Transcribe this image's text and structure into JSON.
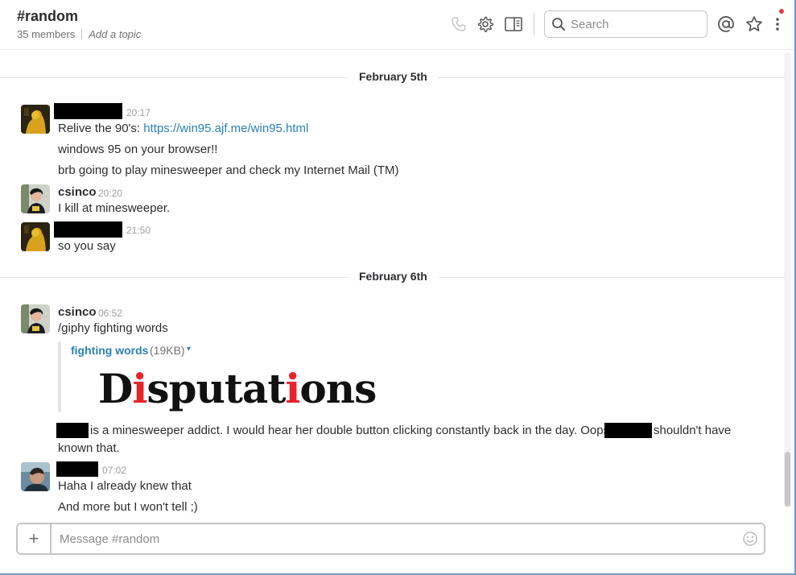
{
  "header": {
    "channel_name": "#random",
    "member_count": "35 members",
    "topic_placeholder": "Add a topic",
    "search_placeholder": "Search"
  },
  "days": [
    {
      "label": "February 5th"
    },
    {
      "label": "February 6th"
    }
  ],
  "messages": [
    {
      "author": "",
      "redacted_author": true,
      "time": "20:17",
      "lines": [
        "Relive the 90's: ",
        "windows 95 on your browser!!",
        "brb going to play minesweeper and check my Internet Mail (TM)"
      ],
      "link": "https://win95.ajf.me/win95.html"
    },
    {
      "author": "csinco",
      "time": "20:20",
      "lines": [
        "I kill at minesweeper."
      ]
    },
    {
      "author": "",
      "redacted_author": true,
      "time": "21:50",
      "lines": [
        "so you say"
      ]
    },
    {
      "author": "csinco",
      "time": "06:52",
      "lines": [
        "/giphy fighting words"
      ]
    },
    {
      "author": "",
      "redacted_author": true,
      "time": "07:02",
      "lines": [
        "Haha I already knew that",
        "And more but I won't tell ;)"
      ]
    }
  ],
  "giphy": {
    "title": "fighting words",
    "size": "(19KB)",
    "caret": "▾",
    "image_text": "Disputations"
  },
  "continuation": {
    "part1": "is a minesweeper addict.  I would hear her double button clicking constantly back in the day.  Oops,",
    "part2": "shouldn't have",
    "part3": "known that."
  },
  "composer": {
    "placeholder": "Message #random",
    "plus": "+"
  },
  "colors": {
    "link": "#2a80b9",
    "notification": "#e8374b",
    "accent_red": "#e8232a"
  },
  "icons": [
    "phone-icon",
    "gear-icon",
    "sidebar-toggle-icon",
    "search-icon",
    "mention-icon",
    "star-icon",
    "more-icon",
    "emoji-icon"
  ]
}
